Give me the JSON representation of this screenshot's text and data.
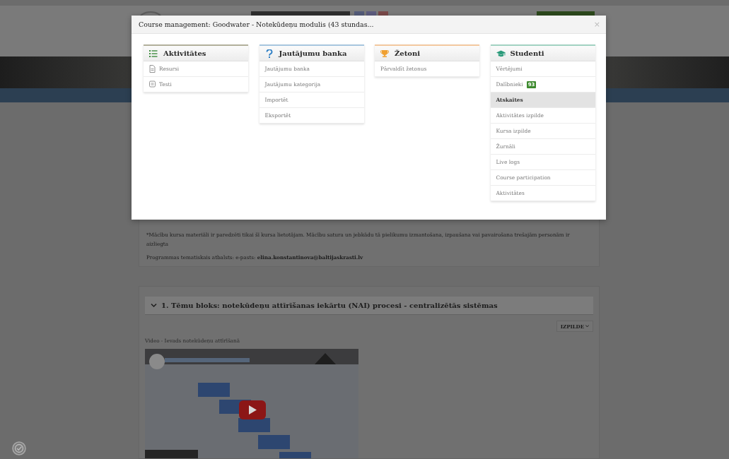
{
  "modal": {
    "title": "Course management: Goodwater - Notekūdeņu modulis (43 stundas...",
    "close": "×",
    "columns": [
      {
        "kind": "activities",
        "title": "Aktivitātes",
        "color": "#b3b19c",
        "items": [
          {
            "kind": "resource",
            "label": "Resursi",
            "selected": false
          },
          {
            "kind": "quiz",
            "label": "Testi",
            "selected": false
          }
        ]
      },
      {
        "kind": "questions",
        "title": "Jautājumu banka",
        "color": "#a8c7df",
        "items": [
          {
            "kind": "link",
            "label": "Jautājumu banka",
            "selected": false
          },
          {
            "kind": "link",
            "label": "Jautājumu kategorija",
            "selected": false
          },
          {
            "kind": "link",
            "label": "Importēt",
            "selected": false
          },
          {
            "kind": "link",
            "label": "Eksportēt",
            "selected": false
          }
        ]
      },
      {
        "kind": "badges",
        "title": "Žetoni",
        "color": "#f3c9a0",
        "items": [
          {
            "kind": "link",
            "label": "Pārvaldīt žetonus",
            "selected": false
          }
        ]
      },
      {
        "kind": "students",
        "title": "Studenti",
        "color": "#a3d3c3",
        "items": [
          {
            "kind": "link",
            "label": "Vērtējumi",
            "selected": false
          },
          {
            "kind": "link",
            "label": "Dalībnieki",
            "badge": "93",
            "selected": false
          },
          {
            "kind": "link",
            "label": "Atskaites",
            "selected": true
          },
          {
            "kind": "link",
            "label": "Aktivitātes izpilde",
            "selected": false
          },
          {
            "kind": "link",
            "label": "Kursa izpilde",
            "selected": false
          },
          {
            "kind": "link",
            "label": "Žurnāli",
            "selected": false
          },
          {
            "kind": "link",
            "label": "Live logs",
            "selected": false
          },
          {
            "kind": "link",
            "label": "Course participation",
            "selected": false
          },
          {
            "kind": "link",
            "label": "Aktivitātes",
            "selected": false
          }
        ]
      }
    ]
  },
  "page": {
    "notice": "*Mācību kursa materiāli ir paredzēti tikai šī kursa lietotājam. Mācību satura un jebkādu tā pielikumu izmantošana, izpaušana vai pavairošana trešajām personām ir aizliegta",
    "contact": "Programmas tematiskais atbalsts: e-pasts: **elina.konstantinova@baltijaskrasti.lv**",
    "section": {
      "title": "1. Tēmu bloks: notekūdeņu attīrīšanas iekārtu (NAI) procesi - centralizētās sistēmas",
      "expanded": true
    },
    "completion_button": "IZPILDE",
    "video_label": "Video - Ievads notekūdeņu attīrīšanā"
  }
}
